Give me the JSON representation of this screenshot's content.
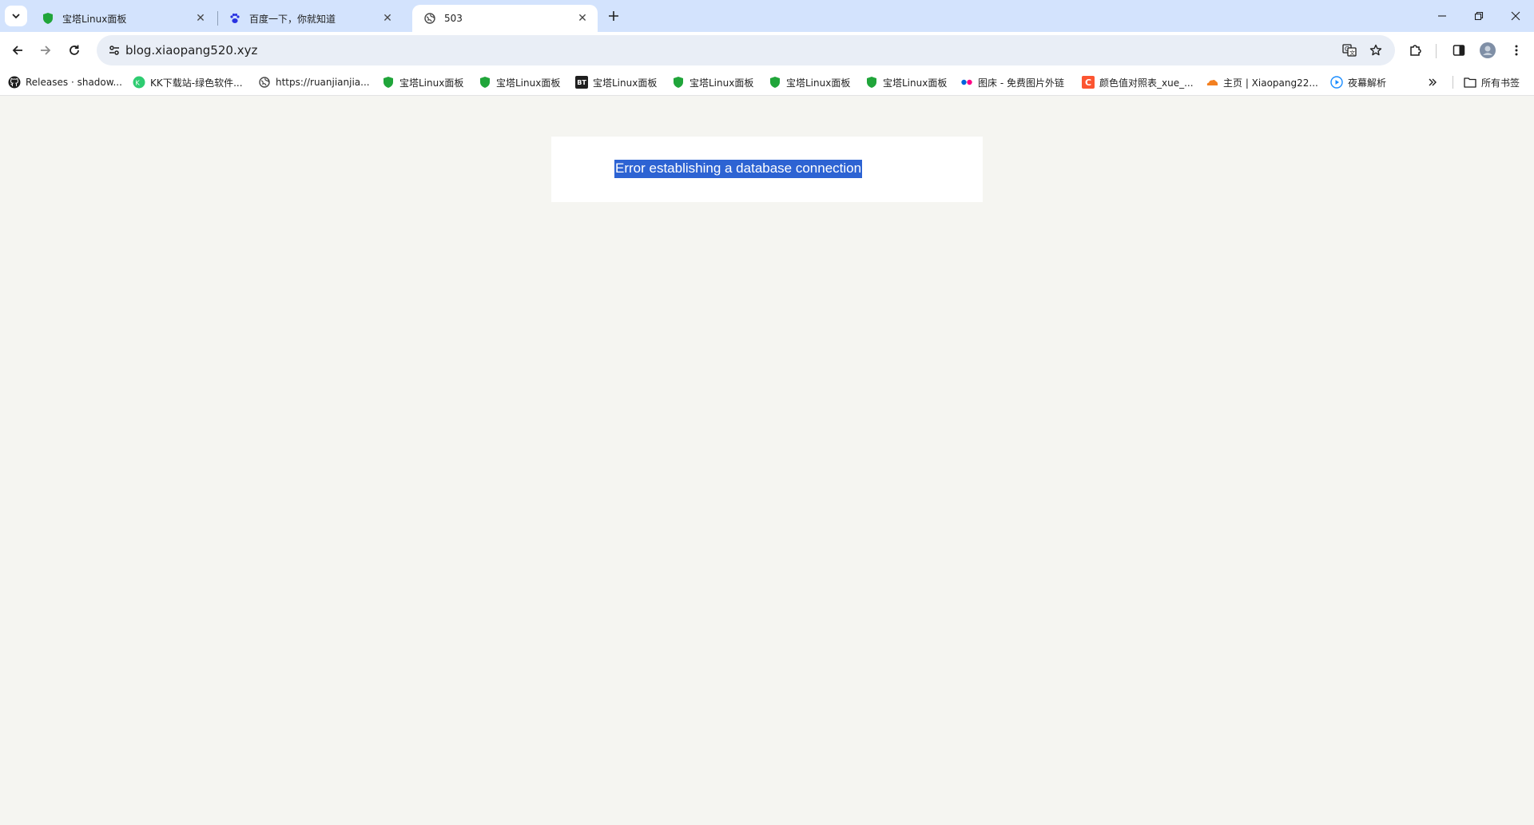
{
  "tabs": [
    {
      "title": "宝塔Linux面板",
      "favicon": "bt-shield-icon",
      "active": false
    },
    {
      "title": "百度一下，你就知道",
      "favicon": "baidu-paw-icon",
      "active": false
    },
    {
      "title": "503",
      "favicon": "globe-icon",
      "active": true
    }
  ],
  "toolbar": {
    "url": "blog.xiaopang520.xyz"
  },
  "bookmarks": [
    {
      "label": "Releases · shadow...",
      "icon": "github-icon"
    },
    {
      "label": "KK下载站-绿色软件...",
      "icon": "kk-icon"
    },
    {
      "label": "https://ruanjianjia...",
      "icon": "globe-icon"
    },
    {
      "label": "宝塔Linux面板",
      "icon": "bt-shield-icon"
    },
    {
      "label": "宝塔Linux面板",
      "icon": "bt-shield-icon"
    },
    {
      "label": "宝塔Linux面板",
      "icon": "bt-logo-icon",
      "badge": "BT"
    },
    {
      "label": "宝塔Linux面板",
      "icon": "bt-shield-icon"
    },
    {
      "label": "宝塔Linux面板",
      "icon": "bt-shield-icon"
    },
    {
      "label": "宝塔Linux面板",
      "icon": "bt-shield-icon"
    },
    {
      "label": "图床 - 免费图片外链",
      "icon": "flickr-dots-icon"
    },
    {
      "label": "颜色值对照表_xue_...",
      "icon": "csdn-c-icon",
      "badge": "C"
    },
    {
      "label": "主页 | Xiaopang22...",
      "icon": "cloudflare-icon"
    },
    {
      "label": "夜幕解析",
      "icon": "play-circle-icon"
    }
  ],
  "all_bookmarks_label": "所有书签",
  "page": {
    "error_message": "Error establishing a database connection"
  },
  "colors": {
    "tab_strip": "#d3e3fd",
    "omnibox": "#e9eef6",
    "page_background": "#f5f5f1",
    "selection": "#2d63d3"
  }
}
